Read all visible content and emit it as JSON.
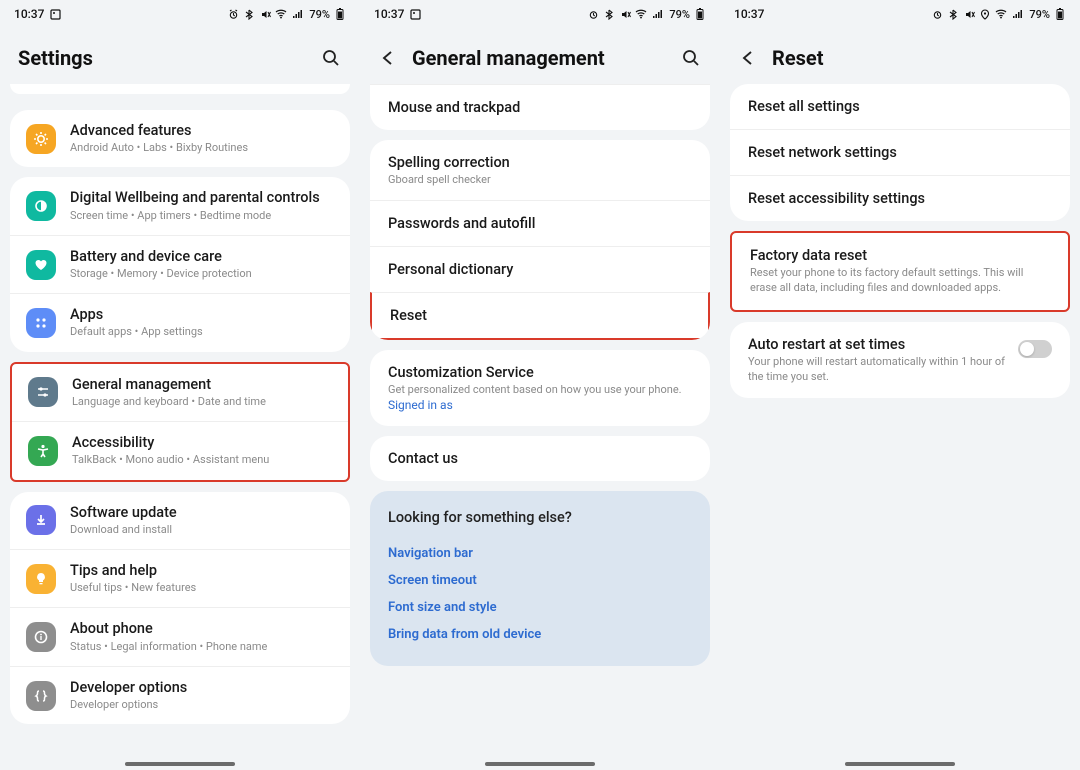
{
  "status": {
    "time": "10:37",
    "battery": "79%"
  },
  "screen1": {
    "title": "Settings",
    "groups": [
      {
        "items": [
          {
            "key": "advanced-features",
            "label": "Advanced features",
            "sub": "Android Auto  •  Labs  •  Bixby Routines",
            "iconColor": "#f6a623"
          }
        ]
      },
      {
        "items": [
          {
            "key": "digital-wellbeing",
            "label": "Digital Wellbeing and parental controls",
            "sub": "Screen time  •  App timers  •  Bedtime mode",
            "iconColor": "#0fb9a0"
          },
          {
            "key": "battery-care",
            "label": "Battery and device care",
            "sub": "Storage  •  Memory  •  Device protection",
            "iconColor": "#0fb9a0"
          },
          {
            "key": "apps",
            "label": "Apps",
            "sub": "Default apps  •  App settings",
            "iconColor": "#5e8df7"
          }
        ]
      },
      {
        "items": [
          {
            "key": "general-management",
            "label": "General management",
            "sub": "Language and keyboard  •  Date and time",
            "iconColor": "#5f7a8c",
            "highlight": true
          },
          {
            "key": "accessibility",
            "label": "Accessibility",
            "sub": "TalkBack  •  Mono audio  •  Assistant menu",
            "iconColor": "#34a853"
          }
        ]
      },
      {
        "items": [
          {
            "key": "software-update",
            "label": "Software update",
            "sub": "Download and install",
            "iconColor": "#6b70e8"
          },
          {
            "key": "tips-help",
            "label": "Tips and help",
            "sub": "Useful tips  •  New features",
            "iconColor": "#f9b233"
          },
          {
            "key": "about-phone",
            "label": "About phone",
            "sub": "Status  •  Legal information  •  Phone name",
            "iconColor": "#8e8e8e"
          },
          {
            "key": "developer-options",
            "label": "Developer options",
            "sub": "Developer options",
            "iconColor": "#8e8e8e"
          }
        ]
      }
    ]
  },
  "screen2": {
    "title": "General management",
    "group1": [
      {
        "key": "mouse-trackpad",
        "label": "Mouse and trackpad"
      }
    ],
    "group2": [
      {
        "key": "spelling",
        "label": "Spelling correction",
        "sub": "Gboard spell checker"
      },
      {
        "key": "passwords-autofill",
        "label": "Passwords and autofill"
      },
      {
        "key": "personal-dictionary",
        "label": "Personal dictionary"
      },
      {
        "key": "reset",
        "label": "Reset",
        "highlight": true
      }
    ],
    "group3": [
      {
        "key": "customization",
        "label": "Customization Service",
        "sub": "Get personalized content based on how you use your phone.",
        "link": "Signed in as"
      }
    ],
    "group4": [
      {
        "key": "contact-us",
        "label": "Contact us"
      }
    ],
    "lookingHeading": "Looking for something else?",
    "lookingLinks": [
      "Navigation bar",
      "Screen timeout",
      "Font size and style",
      "Bring data from old device"
    ]
  },
  "screen3": {
    "title": "Reset",
    "group1": [
      {
        "key": "reset-all",
        "label": "Reset all settings"
      },
      {
        "key": "reset-network",
        "label": "Reset network settings"
      },
      {
        "key": "reset-accessibility",
        "label": "Reset accessibility settings"
      }
    ],
    "group2": [
      {
        "key": "factory-reset",
        "label": "Factory data reset",
        "sub": "Reset your phone to its factory default settings. This will erase all data, including files and downloaded apps.",
        "highlight": true
      }
    ],
    "group3": [
      {
        "key": "auto-restart",
        "label": "Auto restart at set times",
        "sub": "Your phone will restart automatically within 1 hour of the time you set.",
        "toggle": false
      }
    ]
  }
}
